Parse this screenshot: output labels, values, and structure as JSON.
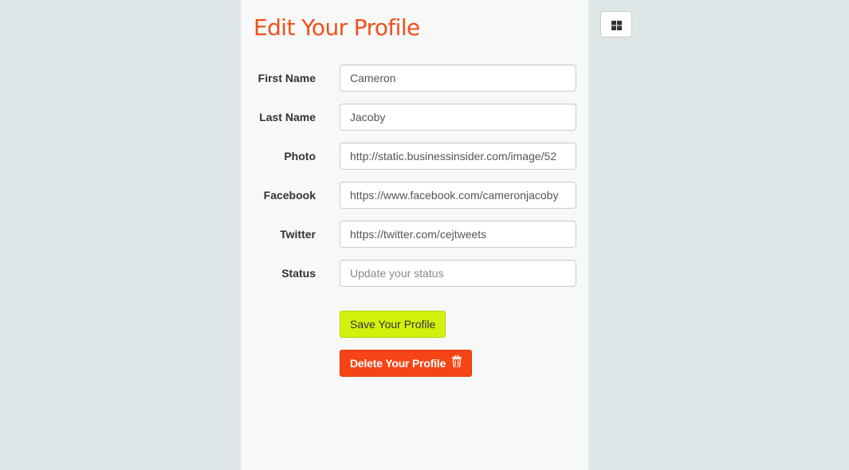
{
  "page": {
    "title": "Edit Your Profile"
  },
  "form": {
    "fields": [
      {
        "label": "First Name",
        "value": "Cameron",
        "placeholder": ""
      },
      {
        "label": "Last Name",
        "value": "Jacoby",
        "placeholder": ""
      },
      {
        "label": "Photo",
        "value": "http://static.businessinsider.com/image/52",
        "placeholder": ""
      },
      {
        "label": "Facebook",
        "value": "https://www.facebook.com/cameronjacoby",
        "placeholder": ""
      },
      {
        "label": "Twitter",
        "value": "https://twitter.com/cejtweets",
        "placeholder": ""
      },
      {
        "label": "Status",
        "value": "",
        "placeholder": "Update your status"
      }
    ],
    "save_label": "Save Your Profile",
    "delete_label": "Delete Your Profile",
    "delete_icon": "trash-icon"
  },
  "toolbar": {
    "grid_icon": "grid-icon"
  },
  "colors": {
    "title": "#f1511b",
    "save_button": "#d2f20d",
    "delete_button": "#f64416",
    "page_background": "#dfe6e7",
    "panel_background": "#f7f8f8"
  }
}
